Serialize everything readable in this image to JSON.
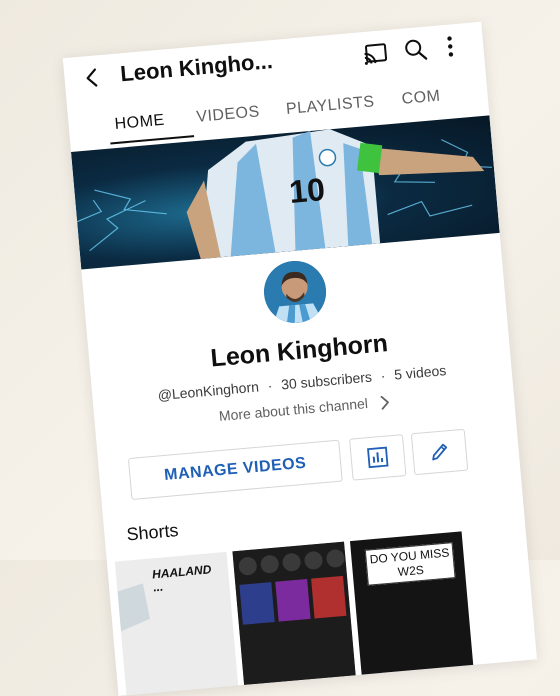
{
  "header": {
    "channel_title": "Leon Kingho...",
    "icons": [
      "back-icon",
      "cast-icon",
      "search-icon",
      "more-vert-icon"
    ]
  },
  "tabs": [
    {
      "label": "HOME",
      "active": true
    },
    {
      "label": "VIDEOS",
      "active": false
    },
    {
      "label": "PLAYLISTS",
      "active": false
    },
    {
      "label": "COM",
      "active": false
    }
  ],
  "channel": {
    "name": "Leon Kinghorn",
    "handle": "@LeonKinghorn",
    "separator": "·",
    "subscribers": "30 subscribers",
    "videos": "5 videos",
    "more_about": "More about this channel"
  },
  "actions": {
    "manage_videos": "MANAGE VIDEOS",
    "icons": [
      "analytics-icon",
      "edit-pencil-icon"
    ]
  },
  "shorts": {
    "label": "Shorts",
    "items": [
      {
        "caption": "HAALAND",
        "caption2": "..."
      },
      {
        "caption": ""
      },
      {
        "caption": "DO YOU MISS",
        "caption2": "W2S"
      }
    ]
  },
  "colors": {
    "accent": "#1f5fb6",
    "text": "#0f0f0f",
    "secondary": "#606060",
    "banner_dark": "#0b2b43",
    "banner_light": "#1d6a8e"
  }
}
